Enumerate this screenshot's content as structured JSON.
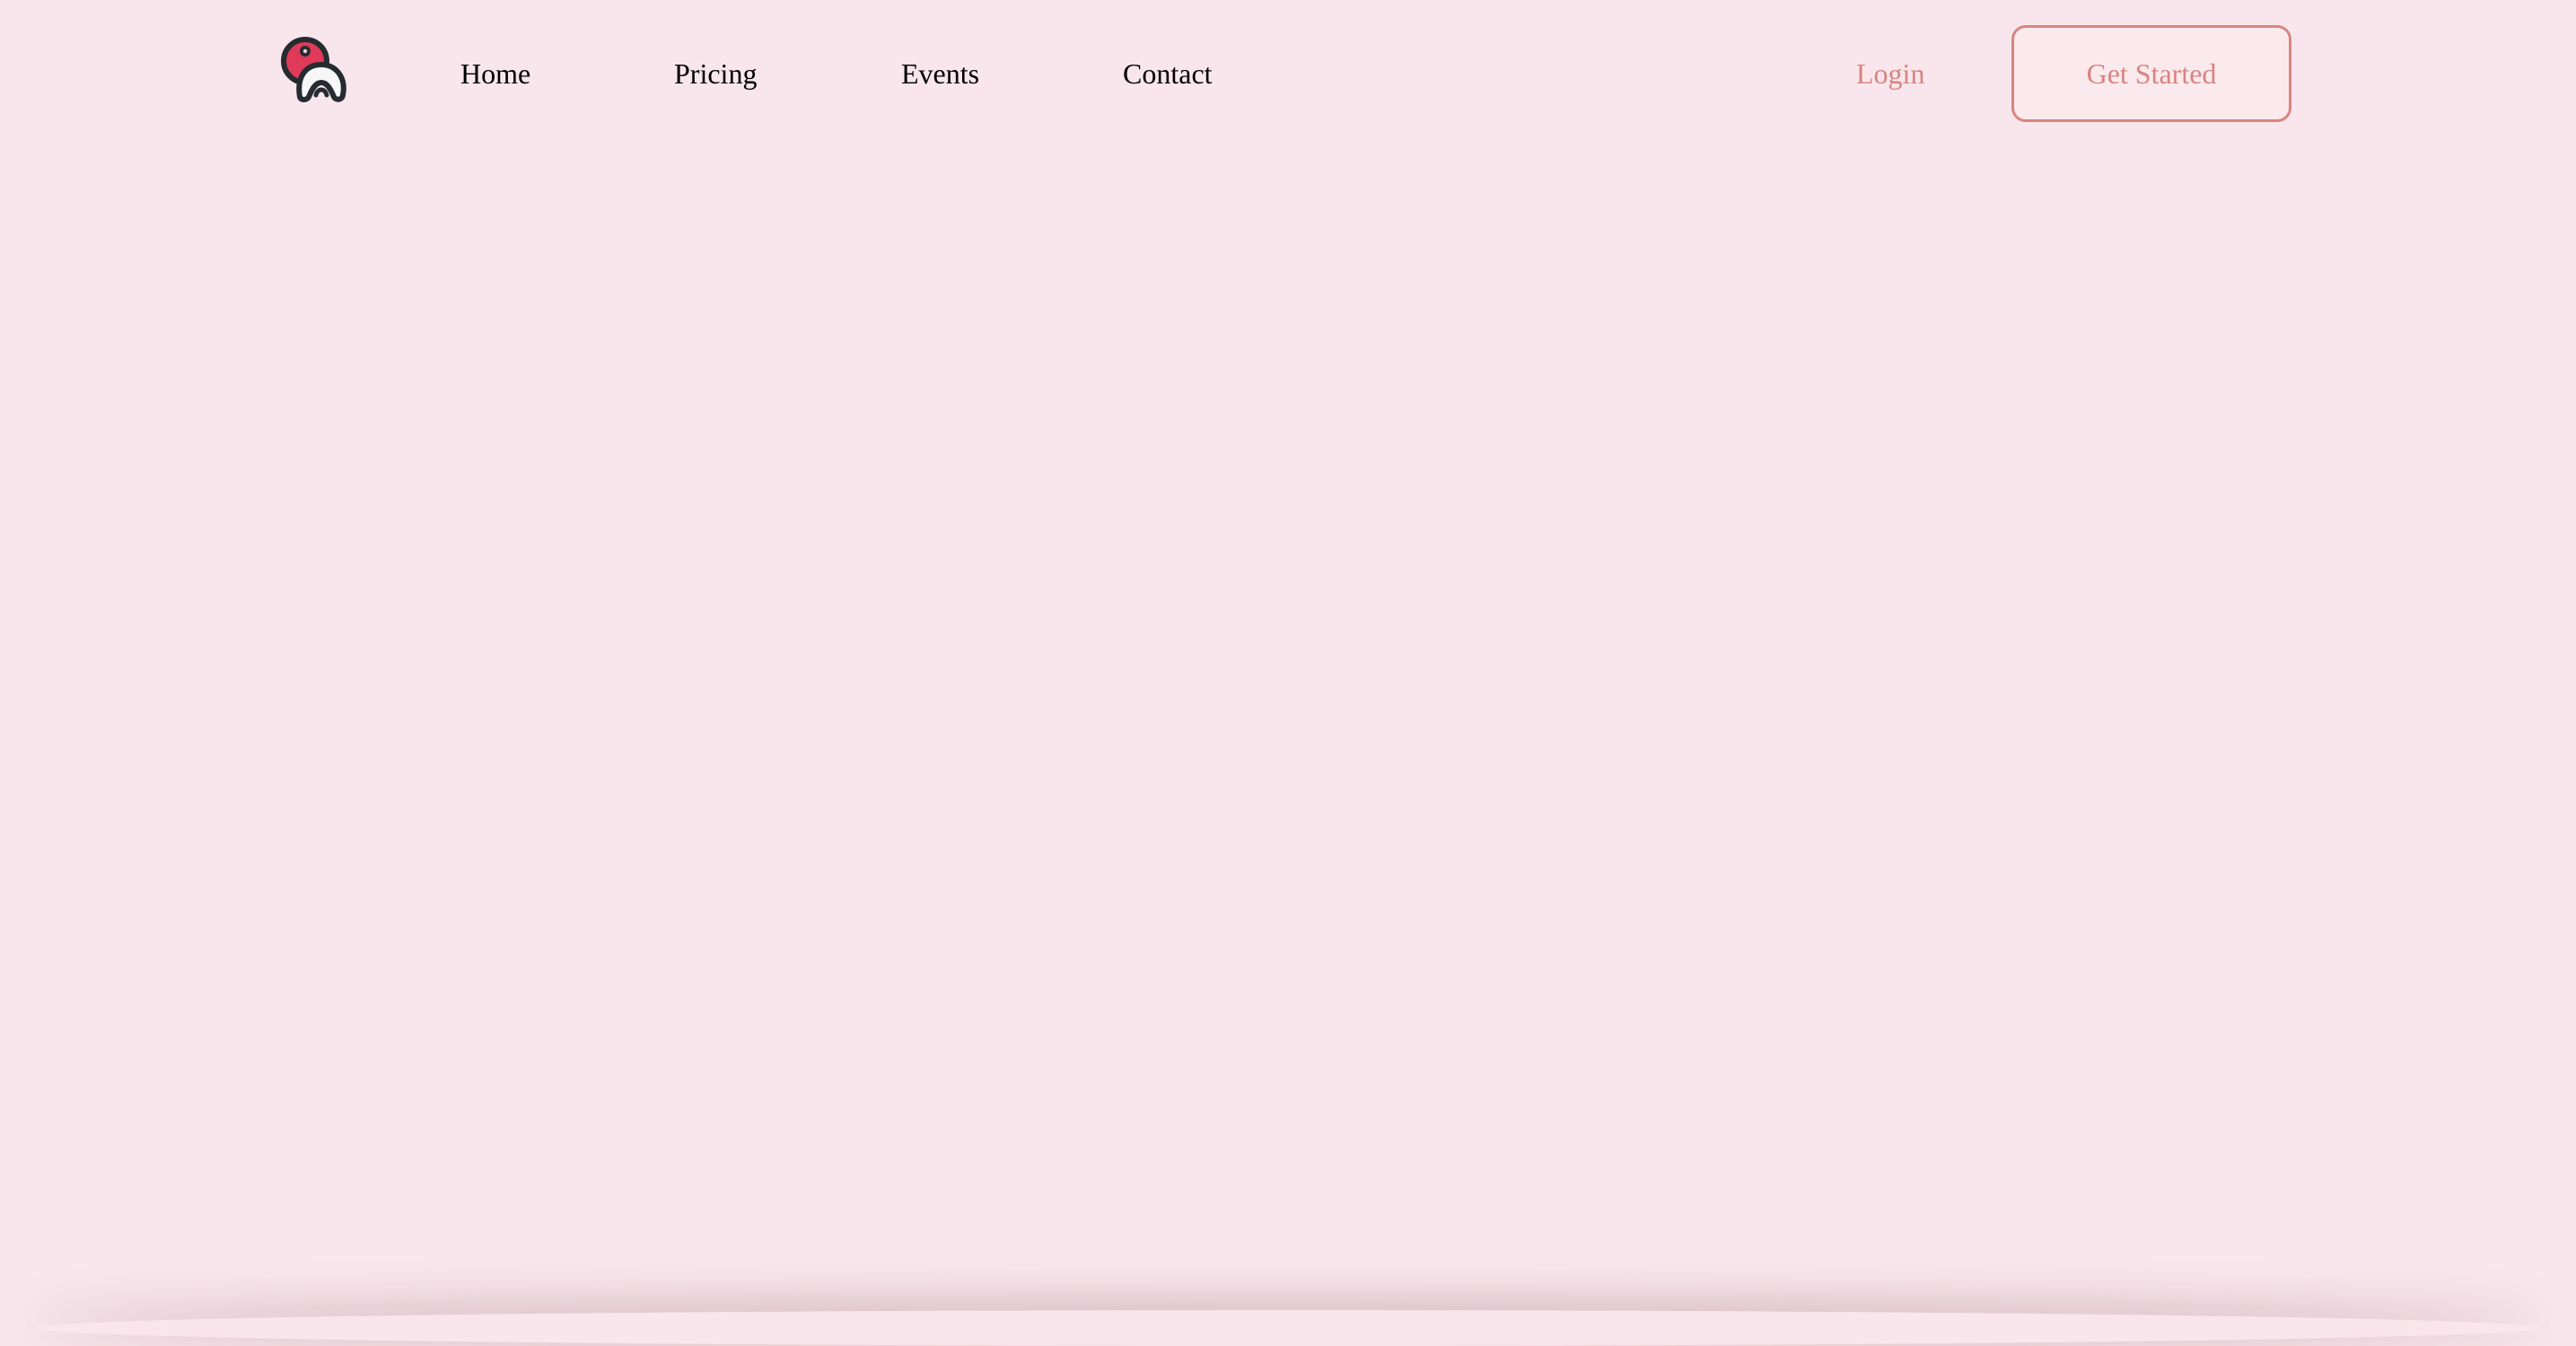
{
  "header": {
    "logo_icon": "mushroom-logo-icon",
    "nav": [
      {
        "label": "Home"
      },
      {
        "label": "Pricing"
      },
      {
        "label": "Events"
      },
      {
        "label": "Contact"
      }
    ],
    "login_label": "Login",
    "cta_label": "Get Started"
  },
  "colors": {
    "background": "#f8e6ec",
    "accent": "#d88480",
    "logo_cap": "#e03a5a",
    "logo_outline": "#262b30"
  }
}
